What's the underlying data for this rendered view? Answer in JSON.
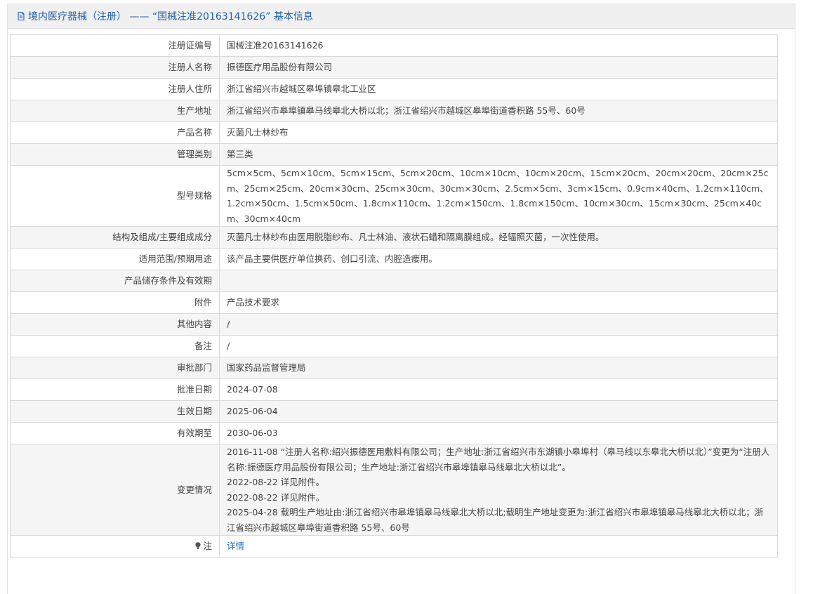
{
  "header": {
    "title": "境内医疗器械（注册） —— “国械注准20163141626” 基本信息"
  },
  "rows": [
    {
      "label": "注册证编号",
      "value": "国械注准20163141626"
    },
    {
      "label": "注册人名称",
      "value": "振德医疗用品股份有限公司"
    },
    {
      "label": "注册人住所",
      "value": "浙江省绍兴市越城区皋埠镇皋北工业区"
    },
    {
      "label": "生产地址",
      "value": "浙江省绍兴市皋埠镇皋马线皋北大桥以北；浙江省绍兴市越城区皋埠街道香积路 55号、60号"
    },
    {
      "label": "产品名称",
      "value": "灭菌凡士林纱布"
    },
    {
      "label": "管理类别",
      "value": "第三类"
    },
    {
      "label": "型号规格",
      "value": "5cm×5cm、5cm×10cm、5cm×15cm、5cm×20cm、10cm×10cm、10cm×20cm、15cm×20cm、20cm×20cm、20cm×25cm、25cm×25cm、20cm×30cm、25cm×30cm、30cm×30cm、2.5cm×5cm、3cm×15cm、0.9cm×40cm、1.2cm×110cm、1.2cm×50cm、1.5cm×50cm、1.8cm×110cm、1.2cm×150cm、1.8cm×150cm、10cm×30cm、15cm×30cm、25cm×40cm、30cm×40cm"
    },
    {
      "label": "结构及组成/主要组成成分",
      "value": "灭菌凡士林纱布由医用脱脂纱布、凡士林油、液状石蜡和隔离膜组成。经辐照灭菌，一次性使用。"
    },
    {
      "label": "适用范围/预期用途",
      "value": "该产品主要供医疗单位换药、创口引流、内腔造瘘用。"
    },
    {
      "label": "产品储存条件及有效期",
      "value": ""
    },
    {
      "label": "附件",
      "value": "产品技术要求"
    },
    {
      "label": "其他内容",
      "value": "/"
    },
    {
      "label": "备注",
      "value": "/"
    },
    {
      "label": "审批部门",
      "value": "国家药品监督管理局"
    },
    {
      "label": "批准日期",
      "value": "2024-07-08"
    },
    {
      "label": "生效日期",
      "value": "2025-06-04"
    },
    {
      "label": "有效期至",
      "value": "2030-06-03"
    }
  ],
  "changes": {
    "label": "变更情况",
    "lines": [
      "2016-11-08 “注册人名称:绍兴振德医用敷料有限公司；生产地址:浙江省绍兴市东湖镇小皋埠村（皋马线以东皋北大桥以北）”变更为“注册人名称:振德医疗用品股份有限公司；生产地址:浙江省绍兴市皋埠镇皋马线皋北大桥以北”。",
      "2022-08-22 详见附件。",
      "2022-08-22 详见附件。",
      "2025-04-28 载明生产地址由:浙江省绍兴市皋埠镇皋马线皋北大桥以北;载明生产地址变更为:浙江省绍兴市皋埠镇皋马线皋北大桥以北；浙江省绍兴市越城区皋埠街道香积路 55号、60号"
    ]
  },
  "note": {
    "label": "注",
    "link_text": "详情"
  },
  "icons": {
    "header": "document-icon",
    "note": "lightbulb-icon"
  },
  "colors": {
    "accent": "#1f5fa8",
    "link": "#1f72c4"
  }
}
